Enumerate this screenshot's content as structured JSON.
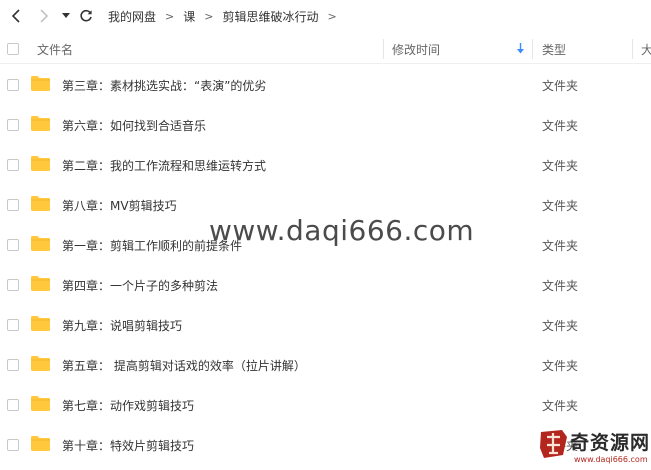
{
  "breadcrumb": {
    "items": [
      "我的网盘",
      "课",
      "剪辑思维破冰行动"
    ],
    "separator": ">"
  },
  "columns": {
    "name": "文件名",
    "modified": "修改时间",
    "type": "类型",
    "size": "大"
  },
  "rows": [
    {
      "name": "第三章：素材挑选实战：“表演”的优劣",
      "type": "文件夹"
    },
    {
      "name": "第六章：如何找到合适音乐",
      "type": "文件夹"
    },
    {
      "name": "第二章：我的工作流程和思维运转方式",
      "type": "文件夹"
    },
    {
      "name": "第八章：MV剪辑技巧",
      "type": "文件夹"
    },
    {
      "name": "第一章：剪辑工作顺利的前提条件",
      "type": "文件夹"
    },
    {
      "name": "第四章：一个片子的多种剪法",
      "type": "文件夹"
    },
    {
      "name": "第九章：说唱剪辑技巧",
      "type": "文件夹"
    },
    {
      "name": "第五章： 提高剪辑对话戏的效率（拉片讲解）",
      "type": "文件夹"
    },
    {
      "name": "第七章：动作戏剪辑技巧",
      "type": "文件夹"
    },
    {
      "name": "第十章：特效片剪辑技巧",
      "type": "文件夹"
    }
  ],
  "watermark": "www.daqi666.com",
  "corner_logo": {
    "text": "奇资源网",
    "url": "www.daqi666.com"
  },
  "icons": {
    "back": "arrow-left-icon",
    "forward": "arrow-right-icon",
    "history": "caret-down-icon",
    "refresh": "refresh-icon",
    "folder": "folder-icon",
    "sort": "sort-down-icon"
  },
  "colors": {
    "folder": "#ffc83d",
    "sort_accent": "#3b8cff",
    "logo_red": "#b3261e"
  }
}
